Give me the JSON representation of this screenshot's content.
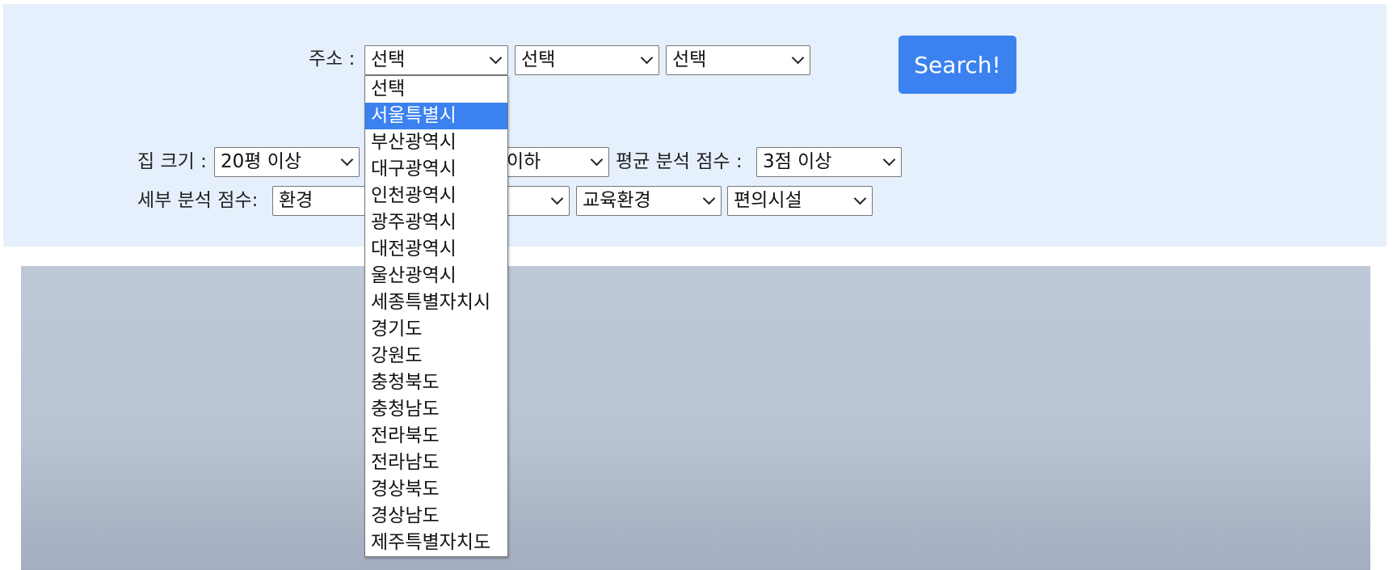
{
  "filters": {
    "address": {
      "label": "주소 :",
      "select1": "선택",
      "select2": "선택",
      "select3": "선택",
      "dropdown_options": [
        "선택",
        "서울특별시",
        "부산광역시",
        "대구광역시",
        "인천광역시",
        "광주광역시",
        "대전광역시",
        "울산광역시",
        "세종특별자치시",
        "경기도",
        "강원도",
        "충청북도",
        "충청남도",
        "전라북도",
        "전라남도",
        "경상북도",
        "경상남도",
        "제주특별자치도"
      ],
      "highlighted_option": "서울특별시"
    },
    "search_button": "Search!",
    "house_size": {
      "label": "집 크기 :",
      "value": "20평 이상"
    },
    "price": {
      "value_partial": "이하"
    },
    "avg_score": {
      "label": "평균 분석 점수 :",
      "value": "3점 이상"
    },
    "detail_score": {
      "label": "세부 분석 점수:",
      "select1": "환경",
      "select3": "교육환경",
      "select4": "편의시설"
    }
  },
  "colors": {
    "panel_bg": "#e6f0fd",
    "accent": "#3b82f0",
    "hero_bg": "#bfc8d7"
  },
  "icons": {
    "select_arrow": "chevron-down-icon"
  }
}
